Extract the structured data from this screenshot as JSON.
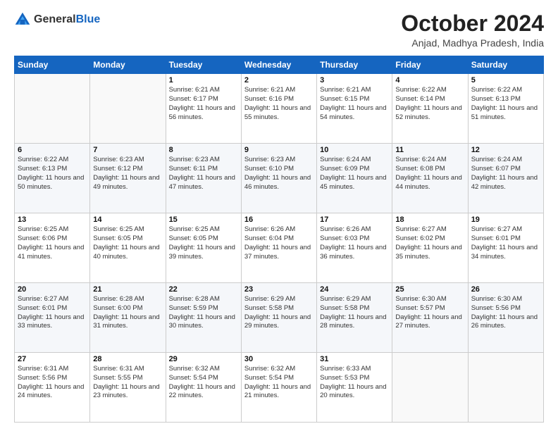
{
  "logo": {
    "general": "General",
    "blue": "Blue"
  },
  "header": {
    "month": "October 2024",
    "location": "Anjad, Madhya Pradesh, India"
  },
  "weekdays": [
    "Sunday",
    "Monday",
    "Tuesday",
    "Wednesday",
    "Thursday",
    "Friday",
    "Saturday"
  ],
  "weeks": [
    [
      {
        "day": "",
        "sunrise": "",
        "sunset": "",
        "daylight": ""
      },
      {
        "day": "",
        "sunrise": "",
        "sunset": "",
        "daylight": ""
      },
      {
        "day": "1",
        "sunrise": "Sunrise: 6:21 AM",
        "sunset": "Sunset: 6:17 PM",
        "daylight": "Daylight: 11 hours and 56 minutes."
      },
      {
        "day": "2",
        "sunrise": "Sunrise: 6:21 AM",
        "sunset": "Sunset: 6:16 PM",
        "daylight": "Daylight: 11 hours and 55 minutes."
      },
      {
        "day": "3",
        "sunrise": "Sunrise: 6:21 AM",
        "sunset": "Sunset: 6:15 PM",
        "daylight": "Daylight: 11 hours and 54 minutes."
      },
      {
        "day": "4",
        "sunrise": "Sunrise: 6:22 AM",
        "sunset": "Sunset: 6:14 PM",
        "daylight": "Daylight: 11 hours and 52 minutes."
      },
      {
        "day": "5",
        "sunrise": "Sunrise: 6:22 AM",
        "sunset": "Sunset: 6:13 PM",
        "daylight": "Daylight: 11 hours and 51 minutes."
      }
    ],
    [
      {
        "day": "6",
        "sunrise": "Sunrise: 6:22 AM",
        "sunset": "Sunset: 6:13 PM",
        "daylight": "Daylight: 11 hours and 50 minutes."
      },
      {
        "day": "7",
        "sunrise": "Sunrise: 6:23 AM",
        "sunset": "Sunset: 6:12 PM",
        "daylight": "Daylight: 11 hours and 49 minutes."
      },
      {
        "day": "8",
        "sunrise": "Sunrise: 6:23 AM",
        "sunset": "Sunset: 6:11 PM",
        "daylight": "Daylight: 11 hours and 47 minutes."
      },
      {
        "day": "9",
        "sunrise": "Sunrise: 6:23 AM",
        "sunset": "Sunset: 6:10 PM",
        "daylight": "Daylight: 11 hours and 46 minutes."
      },
      {
        "day": "10",
        "sunrise": "Sunrise: 6:24 AM",
        "sunset": "Sunset: 6:09 PM",
        "daylight": "Daylight: 11 hours and 45 minutes."
      },
      {
        "day": "11",
        "sunrise": "Sunrise: 6:24 AM",
        "sunset": "Sunset: 6:08 PM",
        "daylight": "Daylight: 11 hours and 44 minutes."
      },
      {
        "day": "12",
        "sunrise": "Sunrise: 6:24 AM",
        "sunset": "Sunset: 6:07 PM",
        "daylight": "Daylight: 11 hours and 42 minutes."
      }
    ],
    [
      {
        "day": "13",
        "sunrise": "Sunrise: 6:25 AM",
        "sunset": "Sunset: 6:06 PM",
        "daylight": "Daylight: 11 hours and 41 minutes."
      },
      {
        "day": "14",
        "sunrise": "Sunrise: 6:25 AM",
        "sunset": "Sunset: 6:05 PM",
        "daylight": "Daylight: 11 hours and 40 minutes."
      },
      {
        "day": "15",
        "sunrise": "Sunrise: 6:25 AM",
        "sunset": "Sunset: 6:05 PM",
        "daylight": "Daylight: 11 hours and 39 minutes."
      },
      {
        "day": "16",
        "sunrise": "Sunrise: 6:26 AM",
        "sunset": "Sunset: 6:04 PM",
        "daylight": "Daylight: 11 hours and 37 minutes."
      },
      {
        "day": "17",
        "sunrise": "Sunrise: 6:26 AM",
        "sunset": "Sunset: 6:03 PM",
        "daylight": "Daylight: 11 hours and 36 minutes."
      },
      {
        "day": "18",
        "sunrise": "Sunrise: 6:27 AM",
        "sunset": "Sunset: 6:02 PM",
        "daylight": "Daylight: 11 hours and 35 minutes."
      },
      {
        "day": "19",
        "sunrise": "Sunrise: 6:27 AM",
        "sunset": "Sunset: 6:01 PM",
        "daylight": "Daylight: 11 hours and 34 minutes."
      }
    ],
    [
      {
        "day": "20",
        "sunrise": "Sunrise: 6:27 AM",
        "sunset": "Sunset: 6:01 PM",
        "daylight": "Daylight: 11 hours and 33 minutes."
      },
      {
        "day": "21",
        "sunrise": "Sunrise: 6:28 AM",
        "sunset": "Sunset: 6:00 PM",
        "daylight": "Daylight: 11 hours and 31 minutes."
      },
      {
        "day": "22",
        "sunrise": "Sunrise: 6:28 AM",
        "sunset": "Sunset: 5:59 PM",
        "daylight": "Daylight: 11 hours and 30 minutes."
      },
      {
        "day": "23",
        "sunrise": "Sunrise: 6:29 AM",
        "sunset": "Sunset: 5:58 PM",
        "daylight": "Daylight: 11 hours and 29 minutes."
      },
      {
        "day": "24",
        "sunrise": "Sunrise: 6:29 AM",
        "sunset": "Sunset: 5:58 PM",
        "daylight": "Daylight: 11 hours and 28 minutes."
      },
      {
        "day": "25",
        "sunrise": "Sunrise: 6:30 AM",
        "sunset": "Sunset: 5:57 PM",
        "daylight": "Daylight: 11 hours and 27 minutes."
      },
      {
        "day": "26",
        "sunrise": "Sunrise: 6:30 AM",
        "sunset": "Sunset: 5:56 PM",
        "daylight": "Daylight: 11 hours and 26 minutes."
      }
    ],
    [
      {
        "day": "27",
        "sunrise": "Sunrise: 6:31 AM",
        "sunset": "Sunset: 5:56 PM",
        "daylight": "Daylight: 11 hours and 24 minutes."
      },
      {
        "day": "28",
        "sunrise": "Sunrise: 6:31 AM",
        "sunset": "Sunset: 5:55 PM",
        "daylight": "Daylight: 11 hours and 23 minutes."
      },
      {
        "day": "29",
        "sunrise": "Sunrise: 6:32 AM",
        "sunset": "Sunset: 5:54 PM",
        "daylight": "Daylight: 11 hours and 22 minutes."
      },
      {
        "day": "30",
        "sunrise": "Sunrise: 6:32 AM",
        "sunset": "Sunset: 5:54 PM",
        "daylight": "Daylight: 11 hours and 21 minutes."
      },
      {
        "day": "31",
        "sunrise": "Sunrise: 6:33 AM",
        "sunset": "Sunset: 5:53 PM",
        "daylight": "Daylight: 11 hours and 20 minutes."
      },
      {
        "day": "",
        "sunrise": "",
        "sunset": "",
        "daylight": ""
      },
      {
        "day": "",
        "sunrise": "",
        "sunset": "",
        "daylight": ""
      }
    ]
  ]
}
